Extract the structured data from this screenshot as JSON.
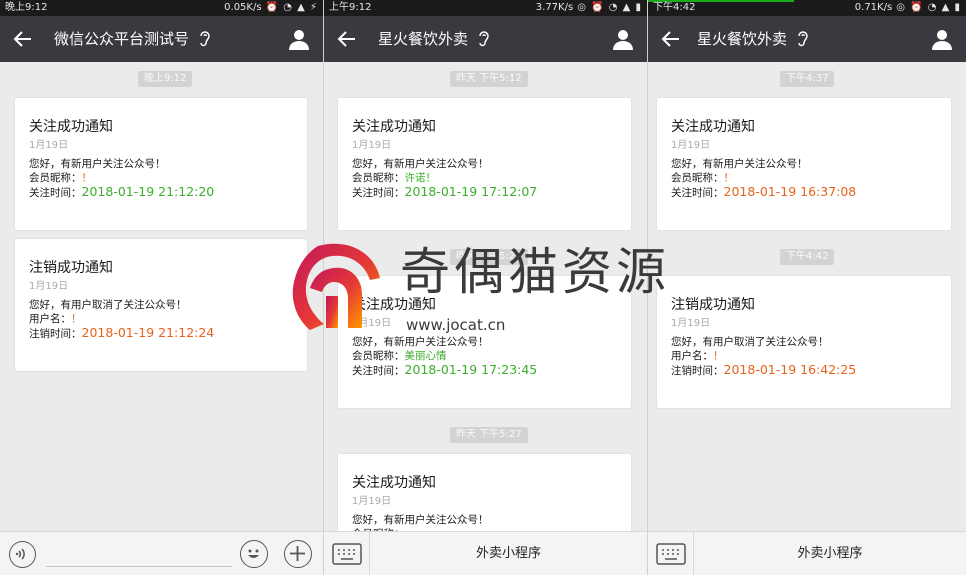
{
  "colors": {
    "titlebar": "#393a3f",
    "green": "#3cae2c",
    "orange": "#e8621c",
    "background": "#ebebeb"
  },
  "panels": [
    {
      "status": {
        "time": "晚上9:12",
        "speed": "0.05K/s"
      },
      "title": "微信公众平台测试号",
      "icons": {
        "back": "back-arrow-icon",
        "ear": "ear-icon",
        "profile": "person-icon"
      },
      "messages": [
        {
          "time": "晚上9:12",
          "card": {
            "title": "关注成功通知",
            "date": "1月19日",
            "greeting": "您好，有新用户关注公众号！",
            "field1_label": "会员昵称：",
            "field1_value": "！",
            "field2_label": "关注时间：",
            "field2_value": "2018-01-19 21:12:20"
          }
        },
        {
          "card": {
            "title": "注销成功通知",
            "date": "1月19日",
            "greeting": "您好，有用户取消了关注公众号！",
            "field1_label": "用户名：",
            "field1_value": "！",
            "field2_label": "注销时间：",
            "field2_value": "2018-01-19 21:12:24"
          }
        }
      ],
      "bottom": {
        "voice_icon": "voice-icon",
        "emoji_icon": "emoji-icon",
        "plus_icon": "plus-icon"
      }
    },
    {
      "status": {
        "time": "上午9:12",
        "speed": "3.77K/s"
      },
      "title": "星火餐饮外卖",
      "icons": {
        "back": "back-arrow-icon",
        "ear": "ear-icon",
        "profile": "person-icon"
      },
      "messages": [
        {
          "time": "昨天 下午5:12",
          "card": {
            "title": "关注成功通知",
            "date": "1月19日",
            "greeting": "您好，有新用户关注公众号！",
            "field1_label": "会员昵称：",
            "field1_value": "许诺！",
            "field2_label": "关注时间：",
            "field2_value": "2018-01-19 17:12:07"
          }
        },
        {
          "time": "昨天 下午5:23",
          "card": {
            "title": "关注成功通知",
            "date": "1月19日",
            "greeting": "您好，有新用户关注公众号！",
            "field1_label": "会员昵称：",
            "field1_value": "美丽心情",
            "field2_label": "关注时间：",
            "field2_value": "2018-01-19 17:23:45"
          }
        },
        {
          "time": "昨天 下午5:27",
          "card": {
            "title": "关注成功通知",
            "date": "1月19日",
            "greeting": "您好，有新用户关注公众号！",
            "field1_label": "会员昵称：",
            "field1_value": ""
          }
        }
      ],
      "bottom": {
        "keyboard_icon": "keyboard-icon",
        "menu_label": "外卖小程序"
      }
    },
    {
      "status": {
        "time": "下午4:42",
        "speed": "0.71K/s"
      },
      "title": "星火餐饮外卖",
      "icons": {
        "back": "back-arrow-icon",
        "ear": "ear-icon",
        "profile": "person-icon"
      },
      "messages": [
        {
          "time": "下午4:37",
          "card": {
            "title": "关注成功通知",
            "date": "1月19日",
            "greeting": "您好，有新用户关注公众号！",
            "field1_label": "会员昵称：",
            "field1_value": "！",
            "field2_label": "关注时间：",
            "field2_value": "2018-01-19 16:37:08"
          }
        },
        {
          "time": "下午4:42",
          "card": {
            "title": "注销成功通知",
            "date": "1月19日",
            "greeting": "您好，有用户取消了关注公众号！",
            "field1_label": "用户名：",
            "field1_value": "！",
            "field2_label": "注销时间：",
            "field2_value": "2018-01-19 16:42:25"
          }
        }
      ],
      "bottom": {
        "keyboard_icon": "keyboard-icon",
        "menu_label": "外卖小程序"
      }
    }
  ],
  "watermark": {
    "text": "奇偶猫资源",
    "url": "www.jocat.cn",
    "logo_icon": "spartan-helmet-logo"
  }
}
